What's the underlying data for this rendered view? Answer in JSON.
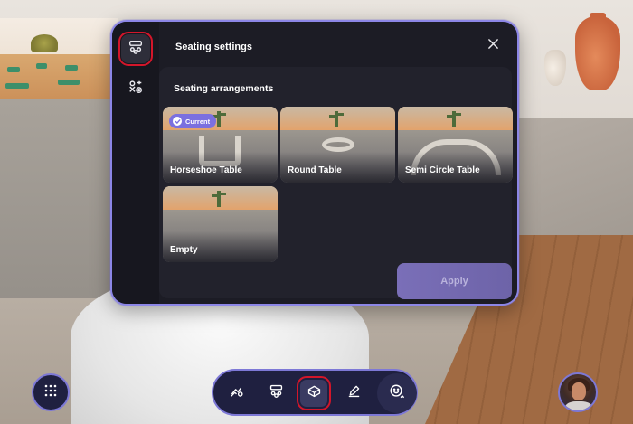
{
  "panel": {
    "title": "Seating settings",
    "close_icon": "close-icon",
    "rail": [
      {
        "icon": "seating-icon",
        "active": true
      },
      {
        "icon": "layout-settings-icon",
        "active": false
      }
    ]
  },
  "seating": {
    "section_title": "Seating arrangements",
    "current_badge": "Current",
    "options": [
      {
        "label": "Horseshoe Table",
        "current": true
      },
      {
        "label": "Round Table",
        "current": false
      },
      {
        "label": "Semi Circle Table",
        "current": false
      },
      {
        "label": "Empty",
        "current": false
      }
    ],
    "apply_label": "Apply"
  },
  "toolbar": {
    "apps_icon": "apps-grid-icon",
    "tools": [
      {
        "icon": "avatar-react-icon"
      },
      {
        "icon": "seating-icon"
      },
      {
        "icon": "room-settings-icon",
        "active": true
      },
      {
        "icon": "pen-icon"
      }
    ],
    "emoji_icon": "emoji-icon"
  },
  "colors": {
    "accent": "#7b70df",
    "highlight": "#d3162a",
    "panel_bg": "#1c1c25"
  }
}
